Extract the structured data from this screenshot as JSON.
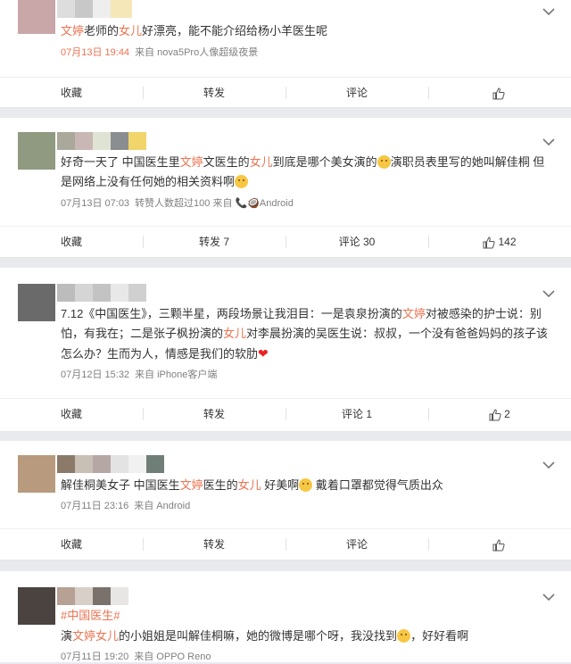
{
  "comments": [
    {
      "segments": [
        {
          "t": "文婷",
          "hl": true
        },
        {
          "t": "老师的"
        },
        {
          "t": "女儿",
          "hl": true
        },
        {
          "t": "好漂亮，能不能介绍给杨小羊医生呢"
        }
      ],
      "date": "07月13日 19:44",
      "source": "来自 nova5Pro人像超级夜景",
      "actions": {
        "fav": "收藏",
        "repost": "转发",
        "comment": "评论",
        "like": ""
      }
    },
    {
      "segments": [
        {
          "t": "好奇一天了 中国医生里"
        },
        {
          "t": "文婷",
          "hl": true
        },
        {
          "t": "文医生的"
        },
        {
          "t": "女儿",
          "hl": true
        },
        {
          "t": "到底是哪个美女演的"
        },
        {
          "emoji": "face"
        },
        {
          "t": "演职员表里写的她叫解佳桐 但是网络上没有任何她的相关资料啊"
        },
        {
          "emoji": "face"
        }
      ],
      "date": "07月13日 07:03",
      "source": "转赞人数超过100  来自 📞🥥Android",
      "actions": {
        "fav": "收藏",
        "repost": "转发 7",
        "comment": "评论 30",
        "like": "142"
      }
    },
    {
      "segments": [
        {
          "t": "7.12《中国医生》，三颗半星，两段场景让我泪目：一是袁泉扮演的"
        },
        {
          "t": "文婷",
          "hl": true
        },
        {
          "t": "对被感染的护士说：别怕，有我在；二是张子枫扮演的"
        },
        {
          "t": "女儿",
          "hl": true
        },
        {
          "t": "对李晨扮演的吴医生说：叔叔，一个没有爸爸妈妈的孩子该怎么办？生而为人，情感是我们的软肋"
        },
        {
          "heart": "❤"
        }
      ],
      "date": "07月12日 15:32",
      "source": "来自 iPhone客户端",
      "actions": {
        "fav": "收藏",
        "repost": "转发",
        "comment": "评论 1",
        "like": "2"
      }
    },
    {
      "segments": [
        {
          "t": "解佳桐美女子 中国医生"
        },
        {
          "t": "文婷",
          "hl": true
        },
        {
          "t": "医生的"
        },
        {
          "t": "女儿",
          "hl": true
        },
        {
          "t": " 好美啊"
        },
        {
          "emoji": "thumb"
        },
        {
          "t": " 戴着口罩都觉得气质出众"
        }
      ],
      "date": "07月11日 23:16",
      "source": "来自 Android",
      "actions": {
        "fav": "收藏",
        "repost": "转发",
        "comment": "评论",
        "like": ""
      }
    },
    {
      "hashtag": "#中国医生#",
      "segments": [
        {
          "t": "演"
        },
        {
          "t": "文婷",
          "hl": true
        },
        {
          "t": "女儿",
          "hl": true
        },
        {
          "t": "的小姐姐是叫解佳桐嘛，她的微博是哪个呀，我没找到"
        },
        {
          "emoji": "cry"
        },
        {
          "t": "，好好看啊"
        }
      ],
      "date": "07月11日 19:20",
      "source": "来自 OPPO Reno"
    }
  ],
  "colors": {
    "highlight": "#eb7350",
    "meta": "#808080",
    "background": "#e9eaee"
  }
}
